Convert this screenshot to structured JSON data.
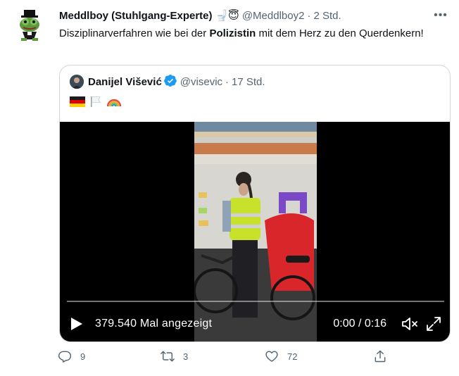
{
  "tweet": {
    "author_name": "Meddlboy (Stuhlgang-Experte)",
    "author_emojis": "🚽😇",
    "author_handle": "@Meddlboy2",
    "separator": "·",
    "time": "2 Std.",
    "text_part1": "Disziplinarverfahren wie bei der ",
    "text_bold": "Polizistin",
    "text_part2": " mit dem Herz zu den Querdenkern!",
    "more_icon": "more-horizontal-icon"
  },
  "quote": {
    "author_name": "Danijel Višević",
    "author_handle": "@visevic",
    "separator": "·",
    "time": "17 Std.",
    "flags": [
      "🇩🇪",
      "🏳️",
      "🌈"
    ]
  },
  "video": {
    "views": "379.540 Mal angezeigt",
    "time": "0:00 / 0:16",
    "progress": 0.0
  },
  "actions": {
    "replies": "9",
    "retweets": "3",
    "likes": "72"
  },
  "colors": {
    "text": "#0f1419",
    "secondary": "#536471",
    "verified": "#1d9bf0",
    "border": "#cfd9de"
  }
}
